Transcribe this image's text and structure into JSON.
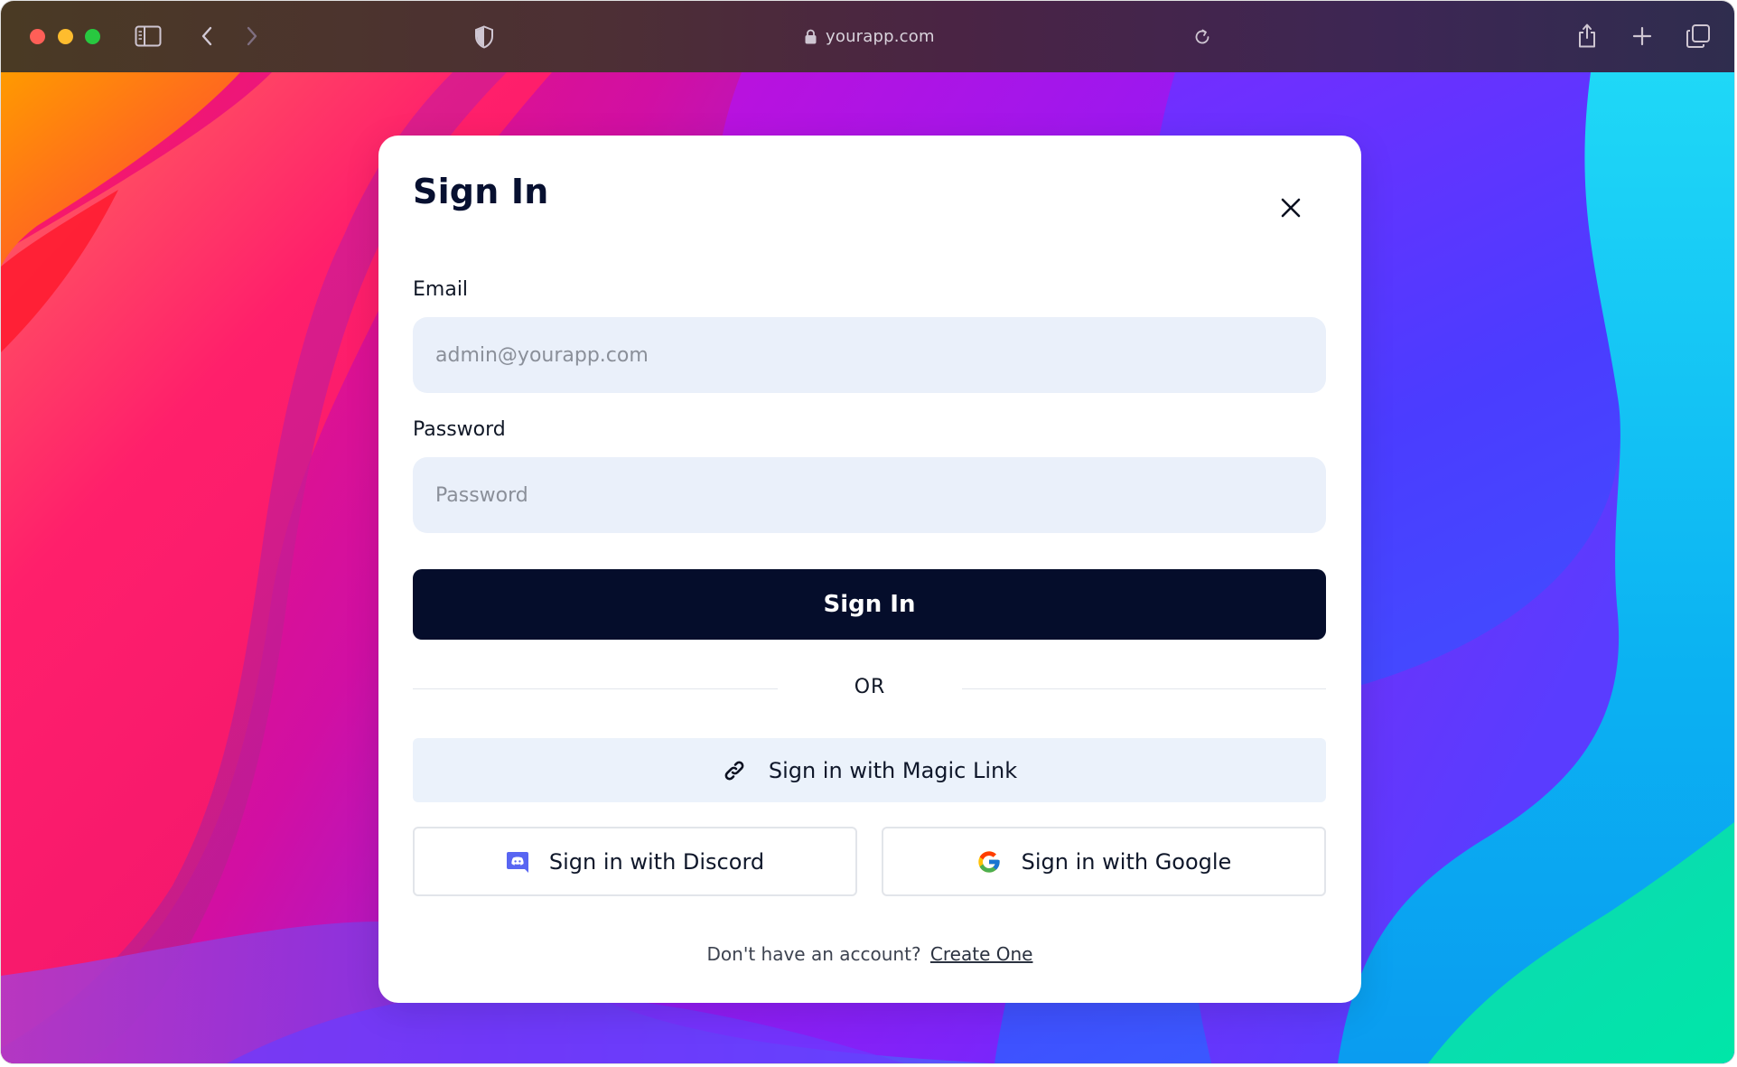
{
  "browser": {
    "url": "yourapp.com",
    "icons": [
      "sidebar-icon",
      "back-icon",
      "forward-icon",
      "shield-icon",
      "lock-icon",
      "reload-icon",
      "share-icon",
      "new-tab-icon",
      "tabs-overview-icon"
    ]
  },
  "modal": {
    "title": "Sign In",
    "close_icon": "close-icon",
    "email": {
      "label": "Email",
      "placeholder": "admin@yourapp.com",
      "value": ""
    },
    "password": {
      "label": "Password",
      "placeholder": "Password",
      "value": ""
    },
    "submit_label": "Sign In",
    "divider_text": "OR",
    "magic_link": {
      "label": "Sign in with Magic Link",
      "icon": "link-icon"
    },
    "discord": {
      "label": "Sign in with Discord",
      "icon": "discord-icon",
      "color": "#5865F2"
    },
    "google": {
      "label": "Sign in with Google",
      "icon": "google-icon"
    },
    "footer": {
      "prompt": "Don't have an account?",
      "link": "Create One"
    }
  },
  "colors": {
    "primary_button": "#050d2b",
    "input_background": "#eaf0fa",
    "magic_button_background": "#ebf2fb"
  }
}
